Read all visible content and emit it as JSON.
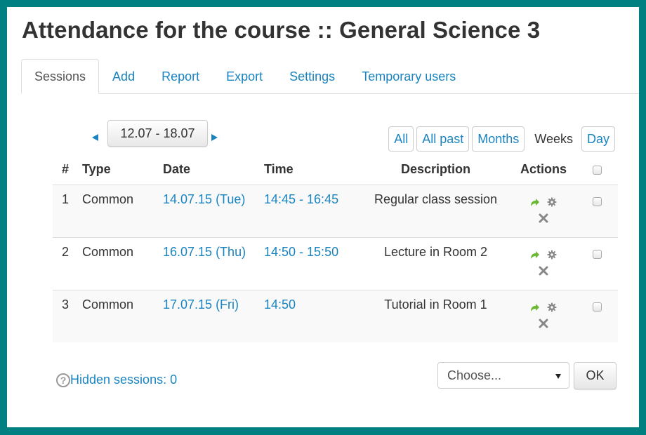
{
  "page": {
    "title": "Attendance for the course :: General Science 3"
  },
  "tabs": [
    {
      "label": "Sessions",
      "active": true
    },
    {
      "label": "Add",
      "active": false
    },
    {
      "label": "Report",
      "active": false
    },
    {
      "label": "Export",
      "active": false
    },
    {
      "label": "Settings",
      "active": false
    },
    {
      "label": "Temporary users",
      "active": false
    }
  ],
  "date_nav": {
    "range": "12.07 - 18.07",
    "prev_icon": "triangle-left-icon",
    "next_icon": "triangle-right-icon"
  },
  "view_filters": {
    "all": "All",
    "all_past": "All past",
    "months": "Months",
    "current": "Weeks",
    "day": "Day"
  },
  "table": {
    "headers": {
      "num": "#",
      "type": "Type",
      "date": "Date",
      "time": "Time",
      "description": "Description",
      "actions": "Actions"
    },
    "rows": [
      {
        "num": "1",
        "type": "Common",
        "date": "14.07.15 (Tue)",
        "time": "14:45 - 16:45",
        "description": "Regular class session"
      },
      {
        "num": "2",
        "type": "Common",
        "date": "16.07.15 (Thu)",
        "time": "14:50 - 15:50",
        "description": "Lecture in Room 2"
      },
      {
        "num": "3",
        "type": "Common",
        "date": "17.07.15 (Fri)",
        "time": "14:50",
        "description": "Tutorial in Room 1"
      }
    ],
    "action_icons": [
      "take-attendance-icon",
      "gear-icon",
      "delete-icon"
    ]
  },
  "footer": {
    "hidden_sessions": "Hidden sessions: 0",
    "bulk_select_value": "Choose...",
    "ok_label": "OK"
  },
  "colors": {
    "frame": "#008080",
    "link": "#1a84c0",
    "arrow_green": "#6ab834",
    "icon_gray": "#888888"
  }
}
